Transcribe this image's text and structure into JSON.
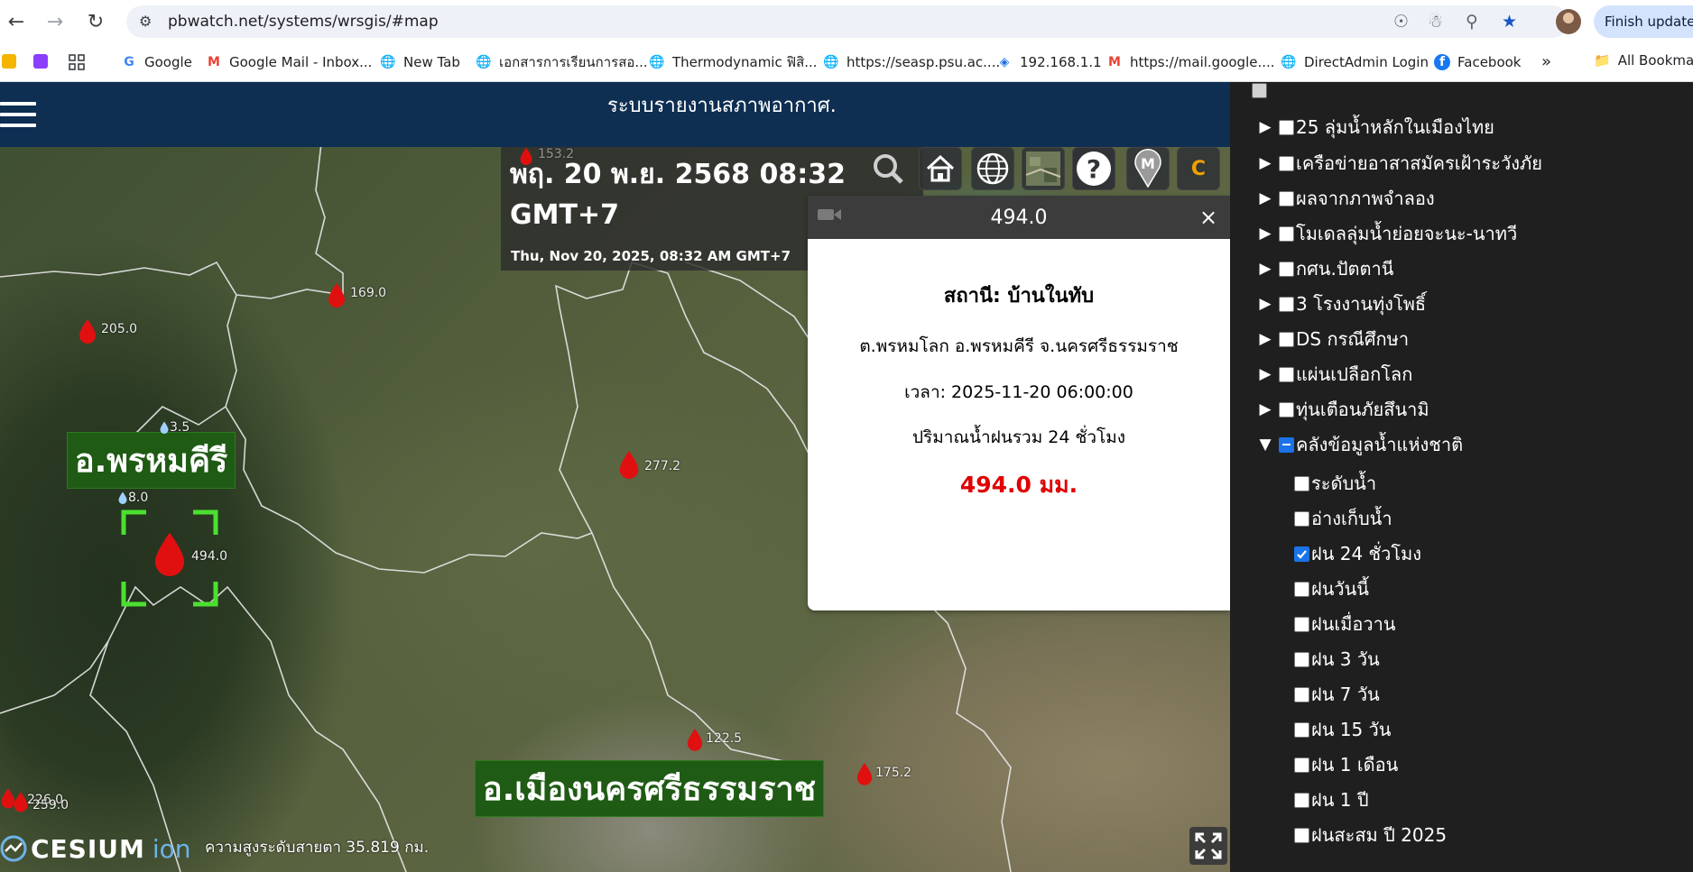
{
  "browser": {
    "url": "pbwatch.net/systems/wrsgis/#map",
    "finish_update": "Finish update",
    "bookmarks": [
      {
        "label": "Google",
        "icon": "google-icon"
      },
      {
        "label": "Google Mail - Inbox...",
        "icon": "gmail-icon"
      },
      {
        "label": "New Tab",
        "icon": "globe-icon"
      },
      {
        "label": "เอกสารการเรียนการสอ...",
        "icon": "globe-icon"
      },
      {
        "label": "Thermodynamic ฟิสิ...",
        "icon": "globe-icon"
      },
      {
        "label": "https://seasp.psu.ac....",
        "icon": "globe-icon"
      },
      {
        "label": "192.168.1.1",
        "icon": "router-icon"
      },
      {
        "label": "https://mail.google....",
        "icon": "gmail-icon"
      },
      {
        "label": "DirectAdmin Login",
        "icon": "globe-icon"
      },
      {
        "label": "Facebook",
        "icon": "facebook-icon"
      }
    ],
    "more_bookmarks": "»",
    "all_bookmarks": "All Bookmarks"
  },
  "header": {
    "title": "ระบบรายงานสภาพอากาศ."
  },
  "clock": {
    "thai_datetime_line1": "พฤ. 20 พ.ย. 2568 08:32",
    "thai_datetime_line2": "GMT+7",
    "english_datetime": "Thu, Nov 20, 2025, 08:32 AM GMT+7"
  },
  "toolbar": {
    "c_button": "C",
    "help_button": "?",
    "m_button": "M"
  },
  "popup": {
    "title": "494.0",
    "close": "×",
    "station": "สถานี: บ้านในทับ",
    "address": "ต.พรหมโลก อ.พรหมคีรี จ.นครศรีธรรมราช",
    "time": "เวลา: 2025-11-20 06:00:00",
    "measure": "ปริมาณน้ำฝนรวม 24 ชั่วโมง",
    "value": "494.0 มม."
  },
  "map": {
    "districts": [
      "อ.พรหมคีรี",
      "อ.เมืองนครศรีธรรมราช"
    ],
    "stations": [
      "169.0",
      "205.0",
      "277.2",
      "494.0",
      "8.0",
      "3.5",
      "122.5",
      "175.2",
      "153.2",
      "226.0",
      "259.0"
    ],
    "cesium_logo": "CESIUM",
    "cesium_ion": "ion",
    "altitude": "ความสูงระดับสายตา 35.819 กม."
  },
  "layers": {
    "top": [
      {
        "label": "25 ลุ่มน้ำหลักในเมืองไทย",
        "expanded": false
      },
      {
        "label": "เครือข่ายอาสาสมัครเฝ้าระวังภัย",
        "expanded": false
      },
      {
        "label": "ผลจากภาพจำลอง",
        "expanded": false
      },
      {
        "label": "โมเดลลุ่มน้ำย่อยจะนะ-นาทวี",
        "expanded": false
      },
      {
        "label": "กศน.ปัตตานี",
        "expanded": false
      },
      {
        "label": "3 โรงงานทุ่งโพธิ์",
        "expanded": false
      },
      {
        "label": "DS กรณีศึกษา",
        "expanded": false
      },
      {
        "label": "แผ่นเปลือกโลก",
        "expanded": false
      },
      {
        "label": "ทุ่นเตือนภัยสึนามิ",
        "expanded": false
      },
      {
        "label": "คลังข้อมูลน้ำแห่งชาติ",
        "expanded": true
      }
    ],
    "sub": [
      {
        "label": "ระดับน้ำ",
        "checked": false
      },
      {
        "label": "อ่างเก็บน้ำ",
        "checked": false
      },
      {
        "label": "ฝน 24 ชั่วโมง",
        "checked": true
      },
      {
        "label": "ฝนวันนี้",
        "checked": false
      },
      {
        "label": "ฝนเมื่อวาน",
        "checked": false
      },
      {
        "label": "ฝน 3 วัน",
        "checked": false
      },
      {
        "label": "ฝน 7 วัน",
        "checked": false
      },
      {
        "label": "ฝน 15 วัน",
        "checked": false
      },
      {
        "label": "ฝน 1 เดือน",
        "checked": false
      },
      {
        "label": "ฝน 1 ปี",
        "checked": false
      },
      {
        "label": "ฝนสะสม ปี 2025",
        "checked": false
      }
    ]
  }
}
